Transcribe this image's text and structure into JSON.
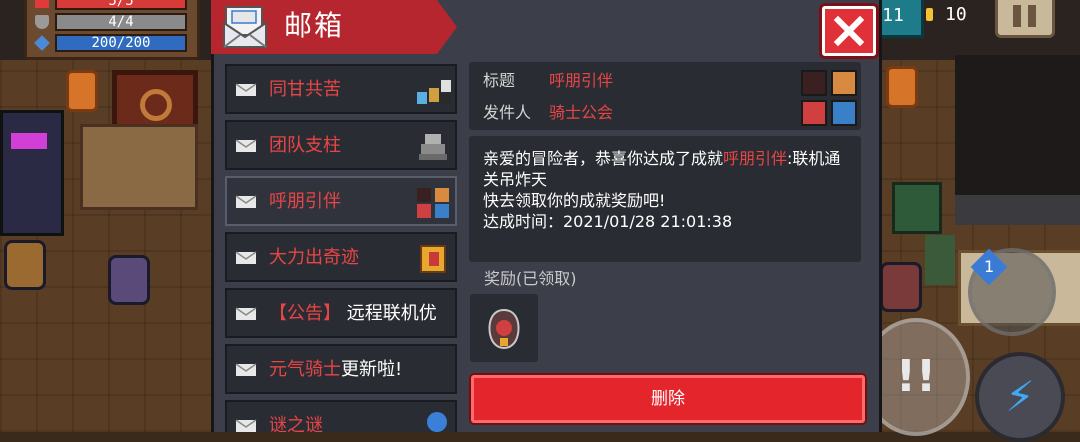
{
  "hud": {
    "hp_text": "5/5",
    "armor_text": "4/4",
    "energy_text": "200/200",
    "gem_count": "11",
    "coin_count": "10",
    "weapon_slot_number": "1"
  },
  "dialog": {
    "title": "邮箱"
  },
  "mail_items": [
    {
      "title_parts": [
        {
          "text": "同甘共苦",
          "red": true
        }
      ],
      "thumb": "pixel-characters"
    },
    {
      "title_parts": [
        {
          "text": "团队支柱",
          "red": true
        }
      ],
      "thumb": "robot-statue"
    },
    {
      "title_parts": [
        {
          "text": "呼朋引伴",
          "red": true
        }
      ],
      "thumb": "pixel-team"
    },
    {
      "title_parts": [
        {
          "text": "大力出奇迹",
          "red": true
        }
      ],
      "thumb": "golden-shield"
    },
    {
      "title_parts": [
        {
          "text": "【公告】",
          "red": true
        },
        {
          "text": " 远程联机优",
          "red": false
        }
      ],
      "thumb": ""
    },
    {
      "title_parts": [
        {
          "text": "元气骑士",
          "red": true
        },
        {
          "text": "更新啦!",
          "red": false
        }
      ],
      "thumb": ""
    },
    {
      "title_parts": [
        {
          "text": "谜之谜",
          "red": true
        }
      ],
      "thumb": "blue-orb"
    }
  ],
  "detail": {
    "subject_label": "标题",
    "subject_value": "呼朋引伴",
    "sender_label": "发件人",
    "sender_value": "骑士公会",
    "body_line1_pre": "亲爱的冒险者，恭喜你达成了成就",
    "body_line1_highlight": "呼朋引伴",
    "body_line1_post": ":联机通关吊炸天",
    "body_line2": "快去领取你的成就奖励吧!",
    "body_line3": "达成时间：2021/01/28 21:01:38",
    "reward_label": "奖励(已领取)",
    "delete_label": "删除"
  },
  "colors": {
    "accent_red": "#e84545",
    "banner_red": "#b5262f",
    "panel_dark": "#2a2c33",
    "dialog_bg": "#3c3f4a"
  }
}
